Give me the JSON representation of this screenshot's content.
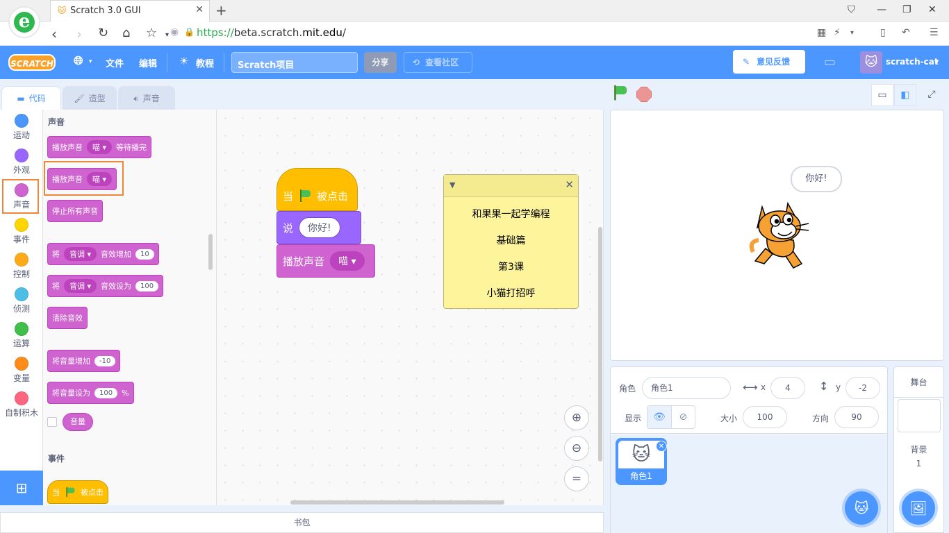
{
  "browser": {
    "tab_title": "Scratch 3.0 GUI",
    "new_tab": "+",
    "url_scheme": "https://",
    "url_host_pre": "beta.scratch.",
    "url_host_main": "mit.edu",
    "url_path": "/"
  },
  "menubar": {
    "logo": "SCRATCH",
    "file": "文件",
    "edit": "编辑",
    "tutorials": "教程",
    "project_title": "Scratch项目",
    "share": "分享",
    "see_community": "查看社区",
    "feedback": "意见反馈",
    "username": "scratch-cat"
  },
  "tabs": {
    "code": "代码",
    "costumes": "造型",
    "sounds": "声音"
  },
  "categories": [
    {
      "label": "运动",
      "color": "#4c97ff"
    },
    {
      "label": "外观",
      "color": "#9966ff"
    },
    {
      "label": "声音",
      "color": "#cf63cf"
    },
    {
      "label": "事件",
      "color": "#ffd500"
    },
    {
      "label": "控制",
      "color": "#ffab19"
    },
    {
      "label": "侦测",
      "color": "#4cbfe6"
    },
    {
      "label": "运算",
      "color": "#40bf4a"
    },
    {
      "label": "变量",
      "color": "#ff8c1a"
    },
    {
      "label": "自制积木",
      "color": "#ff6680"
    }
  ],
  "palette": {
    "sound_heading": "声音",
    "play_until_done": "播放声音",
    "play_until_done_sound": "喵",
    "play_until_done_suffix": "等待播完",
    "start_sound": "播放声音",
    "start_sound_sound": "喵",
    "stop_all": "停止所有声音",
    "change_effect_prefix": "将",
    "change_effect_effect": "音调",
    "change_effect_suffix": "音效增加",
    "change_effect_value": "10",
    "set_effect_prefix": "将",
    "set_effect_effect": "音调",
    "set_effect_suffix": "音效设为",
    "set_effect_value": "100",
    "clear_effects": "清除音效",
    "change_volume": "将音量增加",
    "change_volume_value": "-10",
    "set_volume": "将音量设为",
    "set_volume_value": "100",
    "set_volume_unit": "%",
    "volume_reporter": "音量",
    "events_heading": "事件",
    "when_flag_prefix": "当",
    "when_flag_suffix": "被点击"
  },
  "script": {
    "when_flag_prefix": "当",
    "when_flag_suffix": "被点击",
    "say_label": "说",
    "say_value": "你好!",
    "play_sound_label": "播放声音",
    "play_sound_value": "喵"
  },
  "note": {
    "lines": [
      "和果果一起学编程",
      "基础篇",
      "第3课",
      "小猫打招呼"
    ]
  },
  "backpack": "书包",
  "stage": {
    "bubble": "你好!"
  },
  "sprite_info": {
    "sprite_label": "角色",
    "sprite_name": "角色1",
    "x_label": "x",
    "x_value": "4",
    "y_label": "y",
    "y_value": "-2",
    "show_label": "显示",
    "size_label": "大小",
    "size_value": "100",
    "direction_label": "方向",
    "direction_value": "90",
    "thumb_name": "角色1"
  },
  "stage_pane": {
    "title": "舞台",
    "backdrops_label": "背景",
    "backdrops_count": "1"
  }
}
